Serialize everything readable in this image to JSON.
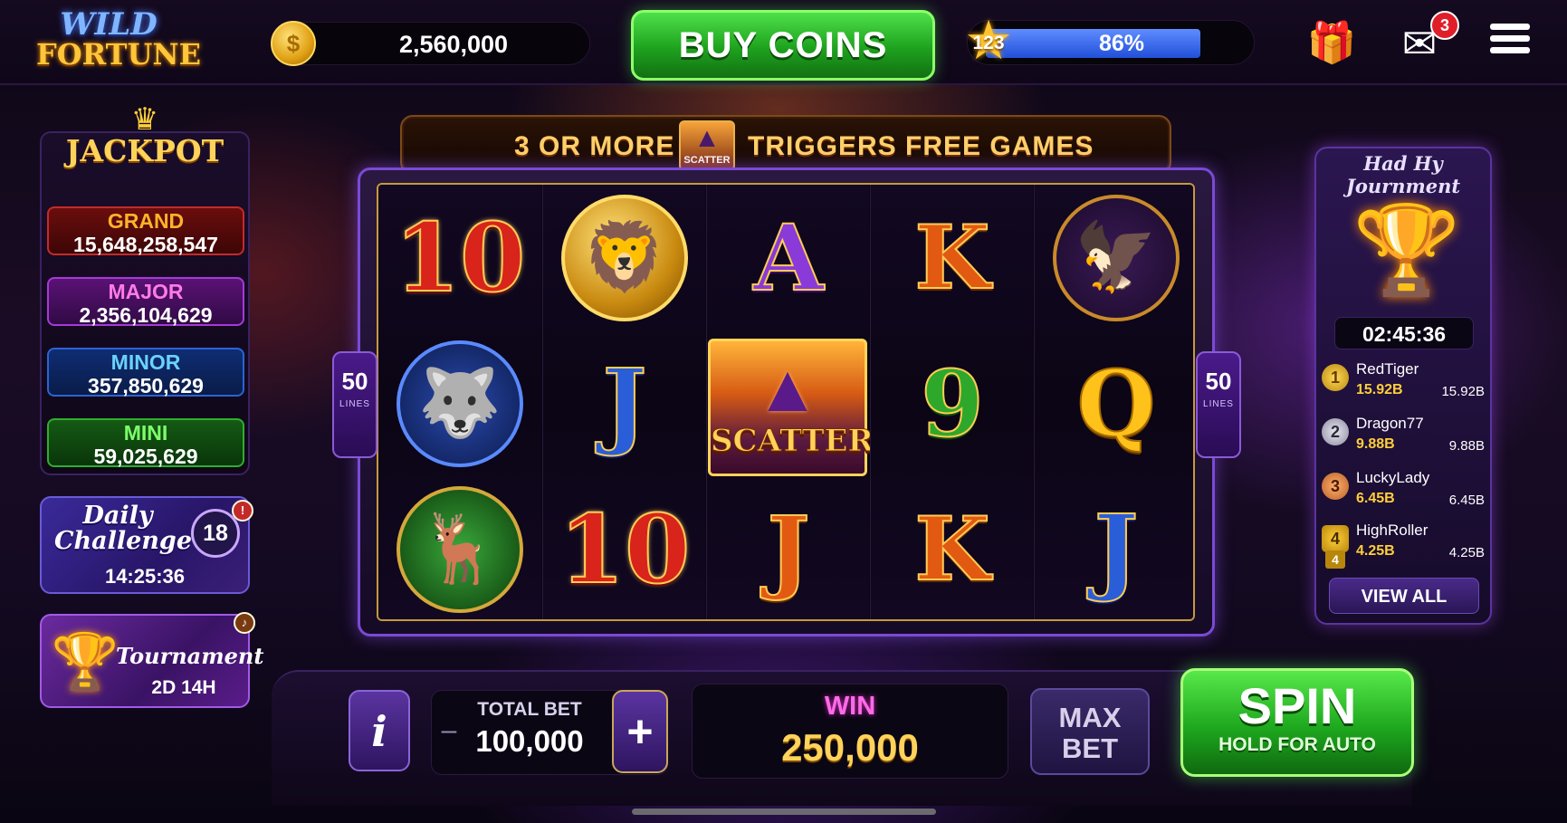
{
  "header": {
    "logo_line1": "WILD",
    "logo_line2": "FORTUNE",
    "coin_icon": "$",
    "coins": "2,560,000",
    "buy_coins_label": "BUY COINS",
    "level": "123",
    "xp_percent": "86%",
    "xp_fraction": 0.86,
    "mail_badge": "3",
    "icons": [
      "coin-icon",
      "star-icon",
      "gift-icon",
      "mail-icon",
      "menu-icon"
    ]
  },
  "jackpot": {
    "title": "JACKPOT",
    "tiers": [
      {
        "label": "GRAND",
        "value": "15,648,258,547"
      },
      {
        "label": "MAJOR",
        "value": "2,356,104,629"
      },
      {
        "label": "MINOR",
        "value": "357,850,629"
      },
      {
        "label": "MINI",
        "value": "59,025,629"
      }
    ]
  },
  "daily_challenge": {
    "title": "Daily Challenge",
    "badge": "18",
    "timer": "14:25:36"
  },
  "tournament_card": {
    "title": "Tournament",
    "time_left": "2D 14H"
  },
  "banner": {
    "left_text": "3 OR MORE",
    "scatter_label": "SCATTER",
    "right_text": "TRIGGERS FREE GAMES"
  },
  "reels": {
    "lines_left": "50",
    "lines_right": "50",
    "lines_word": "LINES",
    "scatter_label": "SCATTER",
    "symbols": [
      [
        "10",
        "lion",
        "A",
        "K",
        "eagle"
      ],
      [
        "wolf",
        "J",
        "scatter",
        "9",
        "Q"
      ],
      [
        "deer",
        "10",
        "J",
        "K",
        "J"
      ]
    ]
  },
  "tournament_panel": {
    "title": "Had Hy Journment",
    "timer": "02:45:36",
    "leaders": [
      {
        "rank": "1",
        "name": "RedTiger",
        "score": "15.92B",
        "score2": "15.92B"
      },
      {
        "rank": "2",
        "name": "Dragon77",
        "score": "9.88B",
        "score2": "9.88B"
      },
      {
        "rank": "3",
        "name": "LuckyLady",
        "score": "6.45B",
        "score2": "6.45B"
      },
      {
        "rank": "4",
        "name": "HighRoller",
        "score": "4.25B",
        "score2": "4.25B"
      }
    ],
    "view_all": "VIEW ALL"
  },
  "controls": {
    "info": "i",
    "minus": "–",
    "total_bet_label": "TOTAL BET",
    "total_bet": "100,000",
    "plus": "+",
    "win_label": "WIN",
    "win_value": "250,000",
    "max_bet_line1": "MAX",
    "max_bet_line2": "BET",
    "spin_label": "SPIN",
    "spin_sub": "HOLD FOR AUTO"
  }
}
